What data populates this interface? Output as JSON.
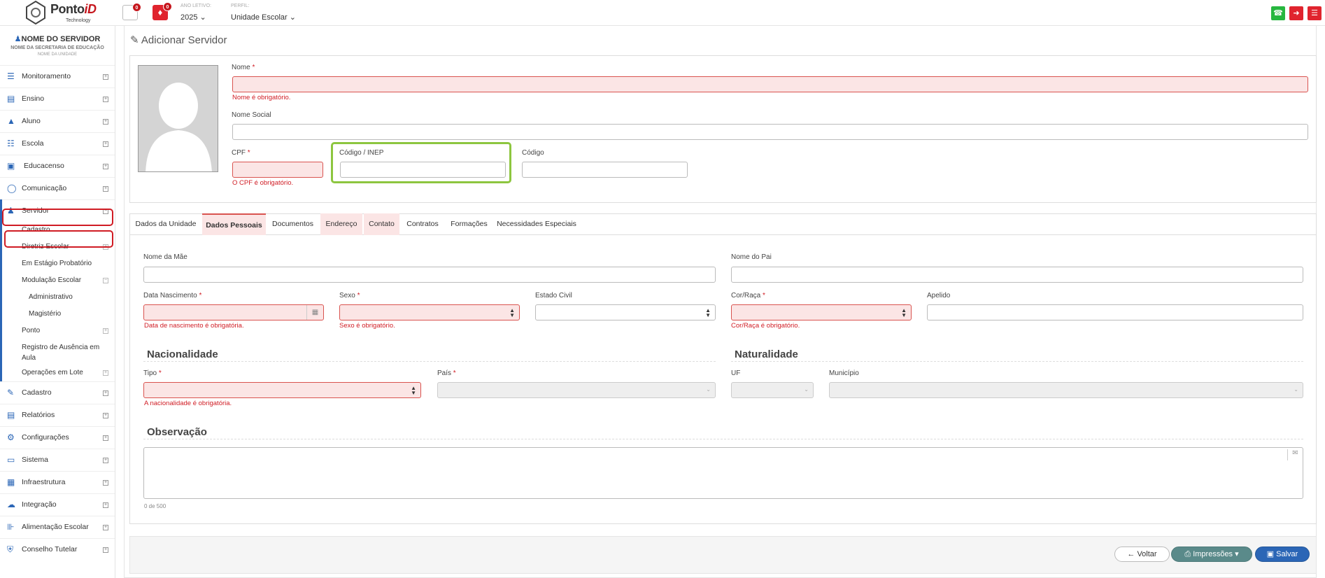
{
  "topbar": {
    "brand_prefix": "Ponto",
    "brand_suffix": "iD",
    "brand_sub": "Technology",
    "inbox_count": "0",
    "alert_count": "0",
    "year_label": "ANO LETIVO:",
    "year_value": "2025",
    "profile_label": "PERFIL:",
    "profile_value": "Unidade Escolar",
    "colors": {
      "whatsapp": "#27b73f",
      "logout": "#e0242e",
      "menu": "#e0242e"
    }
  },
  "sidebar": {
    "user_name": "NOME DO SERVIDOR",
    "secretaria": "NOME DA SECRETARIA DE EDUCAÇÃO",
    "unidade": "NOME DA UNIDADE",
    "items": [
      {
        "label": "Monitoramento",
        "icon": "sliders-icon"
      },
      {
        "label": "Ensino",
        "icon": "book-icon"
      },
      {
        "label": "Aluno",
        "icon": "graduation-cap-icon"
      },
      {
        "label": "Escola",
        "icon": "bank-icon"
      },
      {
        "label": "Educacenso",
        "icon": "id-card-icon"
      },
      {
        "label": "Comunicação",
        "icon": "chat-icon"
      },
      {
        "label": "Servidor",
        "icon": "user-icon"
      }
    ],
    "servidor_sub": [
      {
        "label": "Cadastro"
      },
      {
        "label": "Diretriz Escolar"
      },
      {
        "label": "Em Estágio Probatório"
      },
      {
        "label": "Modulação Escolar"
      },
      {
        "label": "Administrativo"
      },
      {
        "label": "Magistério"
      },
      {
        "label": "Ponto"
      },
      {
        "label": "Registro de Ausência em"
      },
      {
        "label": "Aula"
      },
      {
        "label": "Operações em Lote"
      }
    ],
    "items_after": [
      {
        "label": "Cadastro",
        "icon": "edit-icon"
      },
      {
        "label": "Relatórios",
        "icon": "report-icon"
      },
      {
        "label": "Configurações",
        "icon": "gear-icon"
      },
      {
        "label": "Sistema",
        "icon": "monitor-icon"
      },
      {
        "label": "Infraestrutura",
        "icon": "building-icon"
      },
      {
        "label": "Integração",
        "icon": "cloud-icon"
      },
      {
        "label": "Alimentação Escolar",
        "icon": "cutlery-icon"
      },
      {
        "label": "Conselho Tutelar",
        "icon": "shield-icon"
      }
    ]
  },
  "page": {
    "title": "Adicionar Servidor"
  },
  "form": {
    "nome_label": "Nome",
    "nome_error": "Nome é obrigatório.",
    "nome_social_label": "Nome Social",
    "cpf_label": "CPF",
    "cpf_error": "O CPF é obrigatório.",
    "codigo_inep_label": "Código / INEP",
    "codigo_label": "Código",
    "required_mark": "*"
  },
  "tabs": [
    {
      "label": "Dados da Unidade",
      "state": "normal"
    },
    {
      "label": "Dados Pessoais",
      "state": "active"
    },
    {
      "label": "Documentos",
      "state": "normal"
    },
    {
      "label": "Endereço",
      "state": "error"
    },
    {
      "label": "Contato",
      "state": "error"
    },
    {
      "label": "Contratos",
      "state": "normal"
    },
    {
      "label": "Formações",
      "state": "normal"
    },
    {
      "label": "Necessidades Especiais",
      "state": "normal"
    }
  ],
  "personal": {
    "mae_label": "Nome da Mãe",
    "pai_label": "Nome do Pai",
    "nascimento_label": "Data Nascimento",
    "nascimento_error": "Data de nascimento é obrigatória.",
    "sexo_label": "Sexo",
    "sexo_error": "Sexo é obrigatório.",
    "estado_civil_label": "Estado Civil",
    "cor_label": "Cor/Raça",
    "cor_error": "Cor/Raça é obrigatório.",
    "apelido_label": "Apelido",
    "nacionalidade_title": "Nacionalidade",
    "naturalidade_title": "Naturalidade",
    "tipo_label": "Tipo",
    "tipo_error": "A nacionalidade é obrigatória.",
    "pais_label": "País",
    "uf_label": "UF",
    "municipio_label": "Município",
    "observacao_title": "Observação",
    "counter": "0 de 500"
  },
  "footer": {
    "voltar": "Voltar",
    "impressoes": "Impressões",
    "salvar": "Salvar",
    "colors": {
      "impressoes": "#5a8a8a",
      "salvar": "#2b66b6"
    }
  }
}
